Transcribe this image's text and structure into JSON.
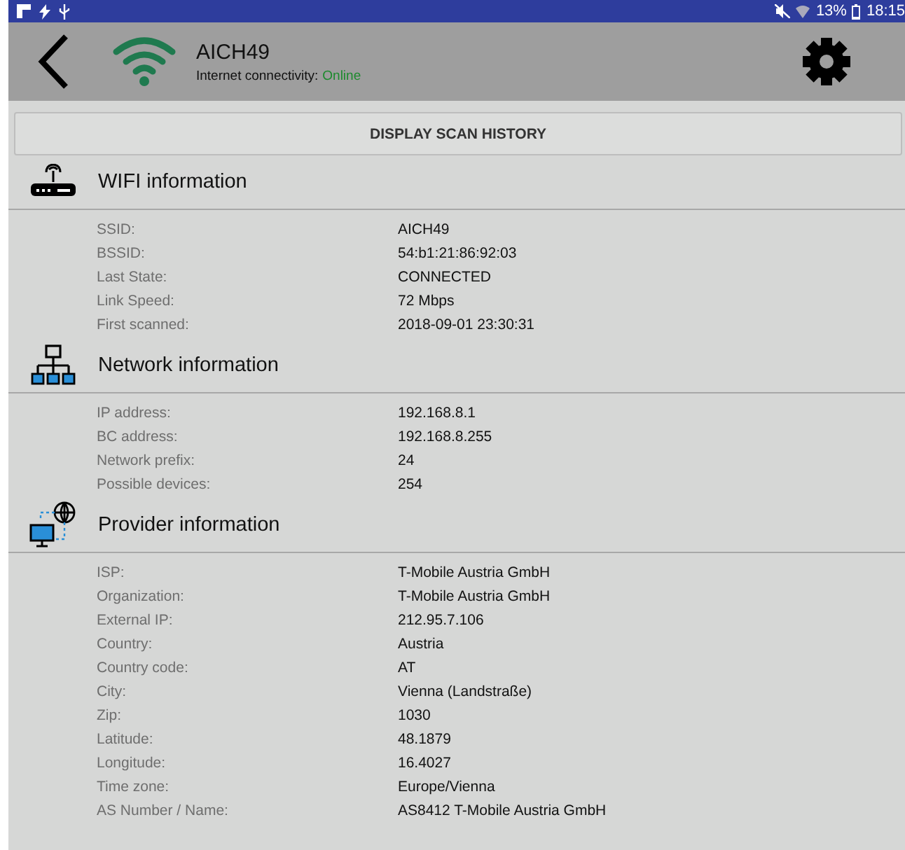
{
  "status_bar": {
    "battery": "13%",
    "time": "18:15"
  },
  "toolbar": {
    "network_name": "AICH49",
    "connectivity_label": "Internet connectivity:",
    "connectivity_value": "Online",
    "online": true
  },
  "scan_history_button": "DISPLAY SCAN HISTORY",
  "sections": [
    {
      "kind": "wifi",
      "title": "WIFI information",
      "rows": [
        {
          "label": "SSID:",
          "value": "AICH49"
        },
        {
          "label": "BSSID:",
          "value": "54:b1:21:86:92:03"
        },
        {
          "label": "Last State:",
          "value": "CONNECTED"
        },
        {
          "label": "Link Speed:",
          "value": "72 Mbps"
        },
        {
          "label": "First scanned:",
          "value": "2018-09-01 23:30:31"
        }
      ]
    },
    {
      "kind": "network",
      "title": "Network information",
      "rows": [
        {
          "label": "IP address:",
          "value": "192.168.8.1"
        },
        {
          "label": "BC address:",
          "value": "192.168.8.255"
        },
        {
          "label": "Network prefix:",
          "value": "24"
        },
        {
          "label": "Possible devices:",
          "value": "254"
        }
      ]
    },
    {
      "kind": "provider",
      "title": "Provider information",
      "rows": [
        {
          "label": "ISP:",
          "value": "T-Mobile Austria GmbH"
        },
        {
          "label": "Organization:",
          "value": "T-Mobile Austria GmbH"
        },
        {
          "label": "External IP:",
          "value": "212.95.7.106"
        },
        {
          "label": "Country:",
          "value": "Austria"
        },
        {
          "label": "Country code:",
          "value": "AT"
        },
        {
          "label": "City:",
          "value": "Vienna (Landstraße)"
        },
        {
          "label": "Zip:",
          "value": "1030"
        },
        {
          "label": "Latitude:",
          "value": "48.1879"
        },
        {
          "label": "Longitude:",
          "value": "16.4027"
        },
        {
          "label": "Time zone:",
          "value": "Europe/Vienna"
        },
        {
          "label": "AS Number / Name:",
          "value": "AS8412 T-Mobile Austria GmbH"
        }
      ]
    }
  ]
}
